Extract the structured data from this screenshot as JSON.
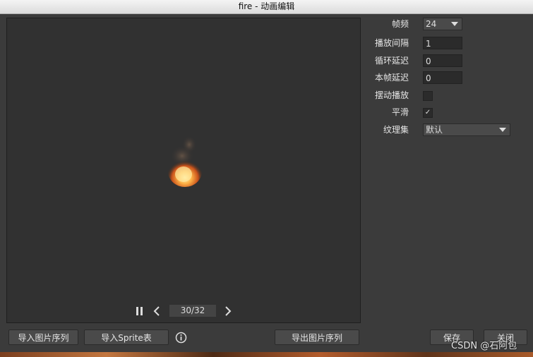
{
  "window": {
    "title": "fire - 动画编辑"
  },
  "player": {
    "frame_display": "30/32"
  },
  "properties": {
    "fps_label": "帧频",
    "fps_value": "24",
    "interval_label": "播放间隔",
    "interval_value": "1",
    "loop_delay_label": "循环延迟",
    "loop_delay_value": "0",
    "frame_delay_label": "本帧延迟",
    "frame_delay_value": "0",
    "pingpong_label": "摆动播放",
    "pingpong_checked": false,
    "smooth_label": "平滑",
    "smooth_checked": true,
    "smooth_mark": "✓",
    "atlas_label": "纹理集",
    "atlas_value": "默认"
  },
  "buttons": {
    "import_sequence": "导入图片序列",
    "import_sprite": "导入Sprite表",
    "export_sequence": "导出图片序列",
    "save": "保存",
    "close": "关闭"
  },
  "watermark": "CSDN @石阿包"
}
